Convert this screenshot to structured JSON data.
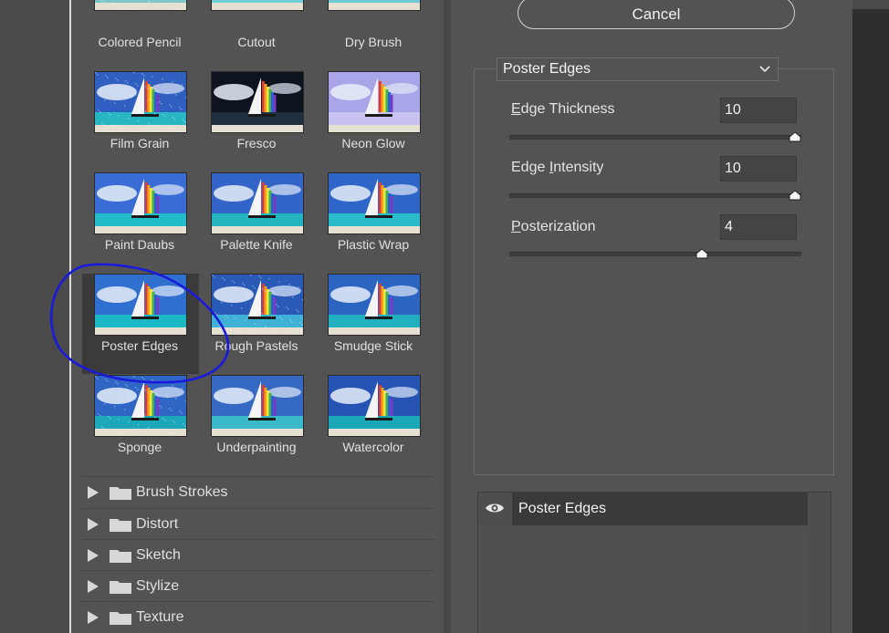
{
  "dialog": {
    "cancel_label": "Cancel"
  },
  "filter_gallery": {
    "thumbnails": [
      {
        "label": "Colored Pencil"
      },
      {
        "label": "Cutout"
      },
      {
        "label": "Dry Brush"
      },
      {
        "label": "Film Grain"
      },
      {
        "label": "Fresco"
      },
      {
        "label": "Neon Glow"
      },
      {
        "label": "Paint Daubs"
      },
      {
        "label": "Palette Knife"
      },
      {
        "label": "Plastic Wrap"
      },
      {
        "label": "Poster Edges"
      },
      {
        "label": "Rough Pastels"
      },
      {
        "label": "Smudge Stick"
      },
      {
        "label": "Sponge"
      },
      {
        "label": "Underpainting"
      },
      {
        "label": "Watercolor"
      }
    ],
    "selected": "Poster Edges",
    "categories": [
      {
        "label": "Brush Strokes"
      },
      {
        "label": "Distort"
      },
      {
        "label": "Sketch"
      },
      {
        "label": "Stylize"
      },
      {
        "label": "Texture"
      }
    ]
  },
  "settings": {
    "filter_select": "Poster Edges",
    "params": [
      {
        "label_mnemonic": "E",
        "label_rest": "dge Thickness",
        "value": "10",
        "fraction": 1.0
      },
      {
        "label_prefix": "Edge ",
        "label_mnemonic": "I",
        "label_rest": "ntensity",
        "value": "10",
        "fraction": 1.0
      },
      {
        "label_mnemonic": "P",
        "label_rest": "osterization",
        "value": "4",
        "fraction": 0.667
      }
    ]
  },
  "layers": {
    "items": [
      {
        "name": "Poster Edges",
        "visible": true
      }
    ]
  },
  "colors": {
    "panel_bg": "#535353",
    "annotation": "#1a1adc",
    "sky": "#2f6fd0",
    "sea": "#19b8c4"
  }
}
